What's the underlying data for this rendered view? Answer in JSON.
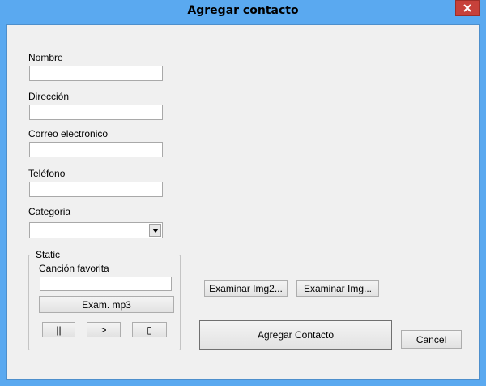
{
  "window": {
    "title": "Agregar contacto",
    "close_icon": "close-icon"
  },
  "form": {
    "nombre": {
      "label": "Nombre",
      "value": ""
    },
    "direccion": {
      "label": "Dirección",
      "value": ""
    },
    "correo": {
      "label": "Correo electronico",
      "value": ""
    },
    "telefono": {
      "label": "Teléfono",
      "value": ""
    },
    "categoria": {
      "label": "Categoria",
      "selected": "",
      "dropdown_icon": "chevron-down-icon"
    }
  },
  "static_group": {
    "legend": "Static",
    "cancion_label": "Canción favorita",
    "cancion_value": "",
    "exam_mp3": "Exam. mp3",
    "pause": "||",
    "play": ">",
    "stop": "▯"
  },
  "buttons": {
    "examinar_img2": "Examinar Img2...",
    "examinar_img": "Examinar Img...",
    "agregar": "Agregar Contacto",
    "cancel": "Cancel"
  },
  "colors": {
    "frame": "#5aa9f0",
    "close": "#c7413a",
    "client": "#f0f0f0"
  }
}
